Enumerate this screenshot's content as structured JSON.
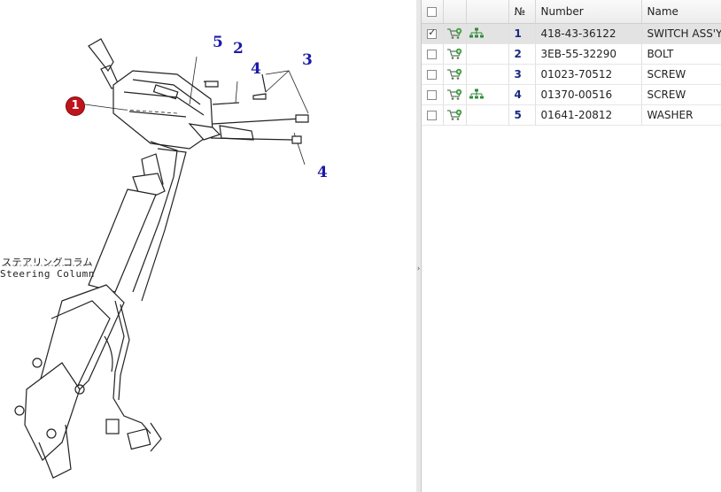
{
  "diagram": {
    "callouts": [
      "5",
      "2",
      "4",
      "3",
      "4"
    ],
    "ref_badge": "1",
    "label_jp": "ステアリングコラム",
    "label_en": "Steering Column"
  },
  "parts_table": {
    "columns": [
      "",
      "",
      "",
      "№",
      "Number",
      "Name"
    ],
    "rows": [
      {
        "checked": true,
        "has_tree": true,
        "no": "1",
        "number": "418-43-36122",
        "name": "SWITCH ASS'Y",
        "selected": true
      },
      {
        "checked": false,
        "has_tree": false,
        "no": "2",
        "number": "3EB-55-32290",
        "name": "BOLT",
        "selected": false
      },
      {
        "checked": false,
        "has_tree": false,
        "no": "3",
        "number": "01023-70512",
        "name": "SCREW",
        "selected": false
      },
      {
        "checked": false,
        "has_tree": true,
        "no": "4",
        "number": "01370-00516",
        "name": "SCREW",
        "selected": false
      },
      {
        "checked": false,
        "has_tree": false,
        "no": "5",
        "number": "01641-20812",
        "name": "WASHER",
        "selected": false
      }
    ]
  },
  "icons": {
    "cart": "add-to-cart-icon",
    "tree": "hierarchy-tree-icon",
    "splitter": "collapse-arrow-icon"
  }
}
